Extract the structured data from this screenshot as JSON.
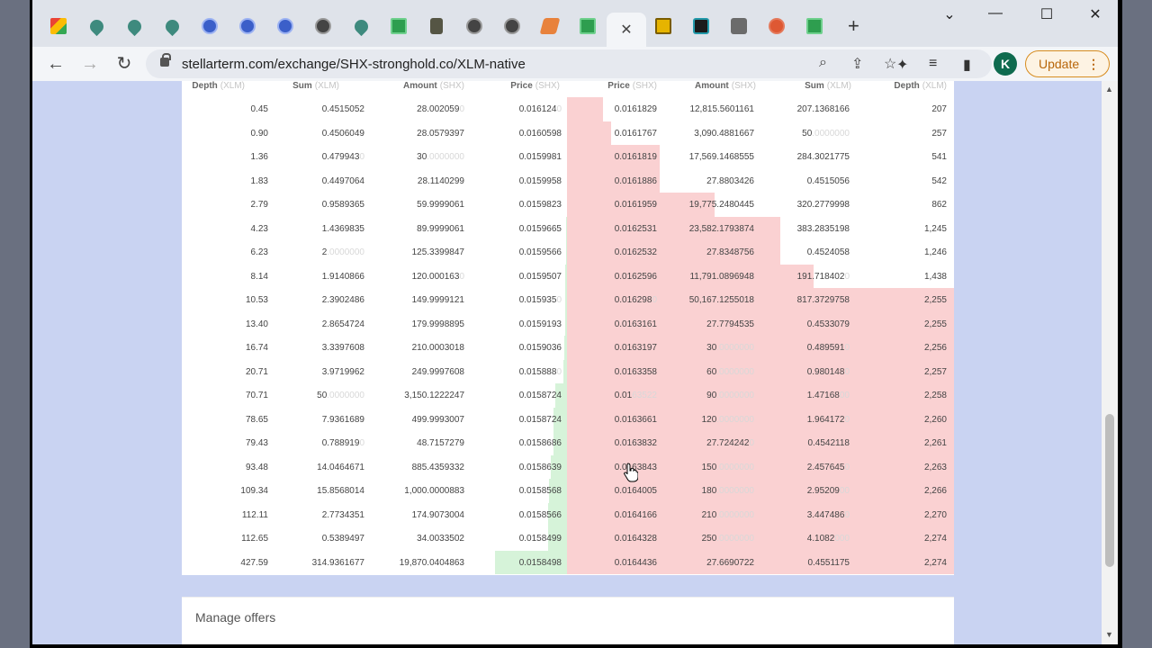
{
  "browser": {
    "tabs": [
      {
        "icon": "gmail-icon",
        "class": "gm"
      },
      {
        "icon": "stellar-drop-icon",
        "class": "drop"
      },
      {
        "icon": "stellar-drop-icon",
        "class": "drop"
      },
      {
        "icon": "stellar-drop-icon",
        "class": "drop"
      },
      {
        "icon": "globe-icon",
        "class": "globe"
      },
      {
        "icon": "globe-icon",
        "class": "globe"
      },
      {
        "icon": "globe-icon",
        "class": "globe"
      },
      {
        "icon": "dark-circle-icon",
        "class": "dark"
      },
      {
        "icon": "stellar-drop-icon",
        "class": "drop"
      },
      {
        "icon": "sheet-icon",
        "class": "grid"
      },
      {
        "icon": "chess-icon",
        "class": "chess"
      },
      {
        "icon": "dark-circle-icon",
        "class": "dark"
      },
      {
        "icon": "dark-circle-icon",
        "class": "dark"
      },
      {
        "icon": "orange-pen-icon",
        "class": "orange"
      },
      {
        "icon": "sheet-icon",
        "class": "grid"
      },
      {
        "icon": "close-icon",
        "class": "active"
      },
      {
        "icon": "yellow-box-icon",
        "class": "yellow"
      },
      {
        "icon": "g-icon",
        "class": "blk"
      },
      {
        "icon": "robot-icon",
        "class": "gray"
      },
      {
        "icon": "duckduckgo-icon",
        "class": "ddg"
      },
      {
        "icon": "sheet-icon",
        "class": "grid"
      }
    ],
    "url": "stellarterm.com/exchange/SHX-stronghold.co/XLM-native",
    "avatar_letter": "K",
    "update_label": "Update"
  },
  "orderbook": {
    "bid_headers": [
      {
        "label": "Depth",
        "unit": "XLM"
      },
      {
        "label": "Sum",
        "unit": "XLM"
      },
      {
        "label": "Amount",
        "unit": "SHX"
      },
      {
        "label": "Price",
        "unit": "SHX"
      }
    ],
    "ask_headers": [
      {
        "label": "Price",
        "unit": "SHX"
      },
      {
        "label": "Amount",
        "unit": "SHX"
      },
      {
        "label": "Sum",
        "unit": "XLM"
      },
      {
        "label": "Depth",
        "unit": "XLM"
      }
    ],
    "bids": [
      {
        "depth": "0.45",
        "sum": "0.4515052",
        "sum_fade": "",
        "amount": "28.002059",
        "amount_fade": "0",
        "price": "0.016124",
        "price_fade": "0",
        "fill": 0.001
      },
      {
        "depth": "0.90",
        "sum": "0.4506049",
        "sum_fade": "",
        "amount": "28.0579397",
        "amount_fade": "",
        "price": "0.0160598",
        "price_fade": "",
        "fill": 0.002
      },
      {
        "depth": "1.36",
        "sum": "0.479943",
        "sum_fade": "0",
        "amount": "30",
        "amount_fade": ".0000000",
        "price": "0.0159981",
        "price_fade": "",
        "fill": 0.003
      },
      {
        "depth": "1.83",
        "sum": "0.4497064",
        "sum_fade": "",
        "amount": "28.1140299",
        "amount_fade": "",
        "price": "0.0159958",
        "price_fade": "",
        "fill": 0.004
      },
      {
        "depth": "2.79",
        "sum": "0.9589365",
        "sum_fade": "",
        "amount": "59.9999061",
        "amount_fade": "",
        "price": "0.0159823",
        "price_fade": "",
        "fill": 0.006
      },
      {
        "depth": "4.23",
        "sum": "1.4369835",
        "sum_fade": "",
        "amount": "89.9999061",
        "amount_fade": "",
        "price": "0.0159665",
        "price_fade": "",
        "fill": 0.01
      },
      {
        "depth": "6.23",
        "sum": "2",
        "sum_fade": ".0000000",
        "amount": "125.3399847",
        "amount_fade": "",
        "price": "0.0159566",
        "price_fade": "",
        "fill": 0.015
      },
      {
        "depth": "8.14",
        "sum": "1.9140866",
        "sum_fade": "",
        "amount": "120.000163",
        "amount_fade": "0",
        "price": "0.0159507",
        "price_fade": "",
        "fill": 0.019
      },
      {
        "depth": "10.53",
        "sum": "2.3902486",
        "sum_fade": "",
        "amount": "149.9999121",
        "amount_fade": "",
        "price": "0.015935",
        "price_fade": "0",
        "fill": 0.025
      },
      {
        "depth": "13.40",
        "sum": "2.8654724",
        "sum_fade": "",
        "amount": "179.9998895",
        "amount_fade": "",
        "price": "0.0159193",
        "price_fade": "",
        "fill": 0.031
      },
      {
        "depth": "16.74",
        "sum": "3.3397608",
        "sum_fade": "",
        "amount": "210.0003018",
        "amount_fade": "",
        "price": "0.0159036",
        "price_fade": "",
        "fill": 0.039
      },
      {
        "depth": "20.71",
        "sum": "3.9719962",
        "sum_fade": "",
        "amount": "249.9997608",
        "amount_fade": "",
        "price": "0.015888",
        "price_fade": "0",
        "fill": 0.048
      },
      {
        "depth": "70.71",
        "sum": "50",
        "sum_fade": ".0000000",
        "amount": "3,150.1222247",
        "amount_fade": "",
        "price": "0.0158724",
        "price_fade": "",
        "fill": 0.165
      },
      {
        "depth": "78.65",
        "sum": "7.9361689",
        "sum_fade": "",
        "amount": "499.9993007",
        "amount_fade": "",
        "price": "0.0158724",
        "price_fade": "",
        "fill": 0.184
      },
      {
        "depth": "79.43",
        "sum": "0.788919",
        "sum_fade": "0",
        "amount": "48.7157279",
        "amount_fade": "",
        "price": "0.0158686",
        "price_fade": "",
        "fill": 0.186
      },
      {
        "depth": "93.48",
        "sum": "14.0464671",
        "sum_fade": "",
        "amount": "885.4359332",
        "amount_fade": "",
        "price": "0.0158639",
        "price_fade": "",
        "fill": 0.219
      },
      {
        "depth": "109.34",
        "sum": "15.8568014",
        "sum_fade": "",
        "amount": "1,000.0000883",
        "amount_fade": "",
        "price": "0.0158568",
        "price_fade": "",
        "fill": 0.256
      },
      {
        "depth": "112.11",
        "sum": "2.7734351",
        "sum_fade": "",
        "amount": "174.9073004",
        "amount_fade": "",
        "price": "0.0158566",
        "price_fade": "",
        "fill": 0.262
      },
      {
        "depth": "112.65",
        "sum": "0.5389497",
        "sum_fade": "",
        "amount": "34.0033502",
        "amount_fade": "",
        "price": "0.0158499",
        "price_fade": "",
        "fill": 0.263
      },
      {
        "depth": "427.59",
        "sum": "314.9361677",
        "sum_fade": "",
        "amount": "19,870.0404863",
        "amount_fade": "",
        "price": "0.0158498",
        "price_fade": "",
        "fill": 1.0
      }
    ],
    "asks": [
      {
        "price": "0.0161829",
        "price_fade": "",
        "amount": "12,815.5601161",
        "amount_fade": "",
        "sum": "207.1368166",
        "sum_fade": "",
        "depth": "207",
        "fill": 0.092
      },
      {
        "price": "0.0161767",
        "price_fade": "",
        "amount": "3,090.4881667",
        "amount_fade": "",
        "sum": "50",
        "sum_fade": ".0000000",
        "depth": "257",
        "fill": 0.114
      },
      {
        "price": "0.0161819",
        "price_fade": "",
        "amount": "17,569.1468555",
        "amount_fade": "",
        "sum": "284.3021775",
        "sum_fade": "",
        "depth": "541",
        "fill": 0.24
      },
      {
        "price": "0.0161886",
        "price_fade": "",
        "amount": "27.8803426",
        "amount_fade": "",
        "sum": "0.4515056",
        "sum_fade": "",
        "depth": "542",
        "fill": 0.24
      },
      {
        "price": "0.0161959",
        "price_fade": "",
        "amount": "19,775.2480445",
        "amount_fade": "",
        "sum": "320.2779998",
        "sum_fade": "",
        "depth": "862",
        "fill": 0.382
      },
      {
        "price": "0.0162531",
        "price_fade": "",
        "amount": "23,582.1793874",
        "amount_fade": "",
        "sum": "383.2835198",
        "sum_fade": "",
        "depth": "1,245",
        "fill": 0.552
      },
      {
        "price": "0.0162532",
        "price_fade": "",
        "amount": "27.8348756",
        "amount_fade": "",
        "sum": "0.4524058",
        "sum_fade": "",
        "depth": "1,246",
        "fill": 0.552
      },
      {
        "price": "0.0162596",
        "price_fade": "",
        "amount": "11,791.0896948",
        "amount_fade": "",
        "sum": "191.718402",
        "sum_fade": "0",
        "depth": "1,438",
        "fill": 0.637
      },
      {
        "price": "0.016298",
        "price_fade": "0",
        "amount": "50,167.1255018",
        "amount_fade": "",
        "sum": "817.3729758",
        "sum_fade": "",
        "depth": "2,255",
        "fill": 1.0
      },
      {
        "price": "0.0163161",
        "price_fade": "",
        "amount": "27.7794535",
        "amount_fade": "",
        "sum": "0.4533079",
        "sum_fade": "",
        "depth": "2,255",
        "fill": 1.0
      },
      {
        "price": "0.0163197",
        "price_fade": "",
        "amount": "30",
        "amount_fade": ".0000000",
        "sum": "0.489591",
        "sum_fade": "0",
        "depth": "2,256",
        "fill": 1.0
      },
      {
        "price": "0.0163358",
        "price_fade": "",
        "amount": "60",
        "amount_fade": ".0000000",
        "sum": "0.980148",
        "sum_fade": "0",
        "depth": "2,257",
        "fill": 1.0
      },
      {
        "price": "0.01",
        "price_fade": "63522",
        "amount": "90",
        "amount_fade": ".0000000",
        "sum": "1.47168",
        "sum_fade": "00",
        "depth": "2,258",
        "fill": 1.0
      },
      {
        "price": "0.0163661",
        "price_fade": "",
        "amount": "120",
        "amount_fade": ".0000000",
        "sum": "1.964172",
        "sum_fade": "0",
        "depth": "2,260",
        "fill": 1.0
      },
      {
        "price": "0.0163832",
        "price_fade": "",
        "amount": "27.724242",
        "amount_fade": "0",
        "sum": "0.4542118",
        "sum_fade": "",
        "depth": "2,261",
        "fill": 1.0
      },
      {
        "price": "0.0163843",
        "price_fade": "",
        "amount": "150",
        "amount_fade": ".0000000",
        "sum": "2.457645",
        "sum_fade": "0",
        "depth": "2,263",
        "fill": 1.0
      },
      {
        "price": "0.0164005",
        "price_fade": "",
        "amount": "180",
        "amount_fade": ".0000000",
        "sum": "2.95209",
        "sum_fade": "00",
        "depth": "2,266",
        "fill": 1.0
      },
      {
        "price": "0.0164166",
        "price_fade": "",
        "amount": "210",
        "amount_fade": ".0000000",
        "sum": "3.447486",
        "sum_fade": "0",
        "depth": "2,270",
        "fill": 1.0
      },
      {
        "price": "0.0164328",
        "price_fade": "",
        "amount": "250",
        "amount_fade": ".0000000",
        "sum": "4.1082",
        "sum_fade": "000",
        "depth": "2,274",
        "fill": 1.0
      },
      {
        "price": "0.0164436",
        "price_fade": "",
        "amount": "27.6690722",
        "amount_fade": "",
        "sum": "0.4551175",
        "sum_fade": "",
        "depth": "2,274",
        "fill": 1.0
      }
    ]
  },
  "manage_offers": {
    "title": "Manage offers"
  }
}
